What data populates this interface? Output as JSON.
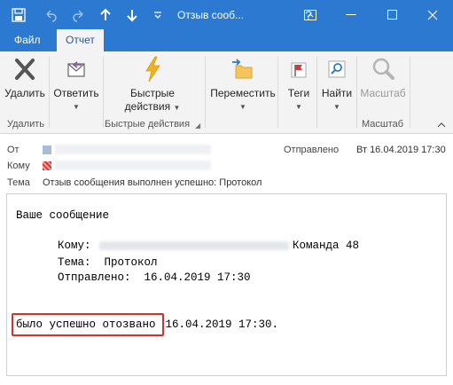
{
  "window": {
    "title": "Отзыв сооб...",
    "qat": {
      "save": "💾",
      "undo": "↶",
      "redo": "↷",
      "up": "↑",
      "down": "↓",
      "more": "⌄"
    },
    "buttons": {
      "help": "?",
      "restore": "▭",
      "minimize": "—",
      "maximize": "☐",
      "close": "✕"
    }
  },
  "tabs": [
    {
      "label": "Файл",
      "active": false
    },
    {
      "label": "Отчет",
      "active": true
    }
  ],
  "ribbon": {
    "buttons": [
      {
        "label": "Удалить",
        "icon": "delete-x-icon"
      },
      {
        "label": "Ответить",
        "icon": "reply-envelope-icon",
        "dropdown": true
      },
      {
        "label": "Быстрые",
        "label2": "действия",
        "icon": "lightning-icon",
        "dropdown": true
      },
      {
        "label": "Переместить",
        "icon": "move-folder-icon",
        "dropdown": true
      },
      {
        "label": "Теги",
        "icon": "flag-icon",
        "dropdown": true
      },
      {
        "label": "Найти",
        "icon": "find-icon",
        "dropdown": true
      },
      {
        "label": "Масштаб",
        "icon": "zoom-magnifier-icon",
        "disabled": true
      }
    ],
    "groups": [
      "Удалить",
      "Быстрые действия",
      "Масштаб"
    ]
  },
  "header": {
    "from_label": "От",
    "to_label": "Кому",
    "subject_label": "Тема",
    "subject": "Отзыв сообщения выполнен успешно: Протокол",
    "sent_label": "Отправлено",
    "sent_value": "Вт 16.04.2019 17:30",
    "colors": {
      "from": "#a6bdd4",
      "to": "#d23a3a"
    }
  },
  "message": {
    "line1": "Ваше сообщение",
    "to_label": "Кому:",
    "to_suffix": "Команда 48",
    "subject_line": "Тема:  Протокол",
    "sent_line": "Отправлено:  16.04.2019 17:30",
    "recalled_text": "было успешно отозвано",
    "recalled_rest": " 16.04.2019 17:30."
  }
}
